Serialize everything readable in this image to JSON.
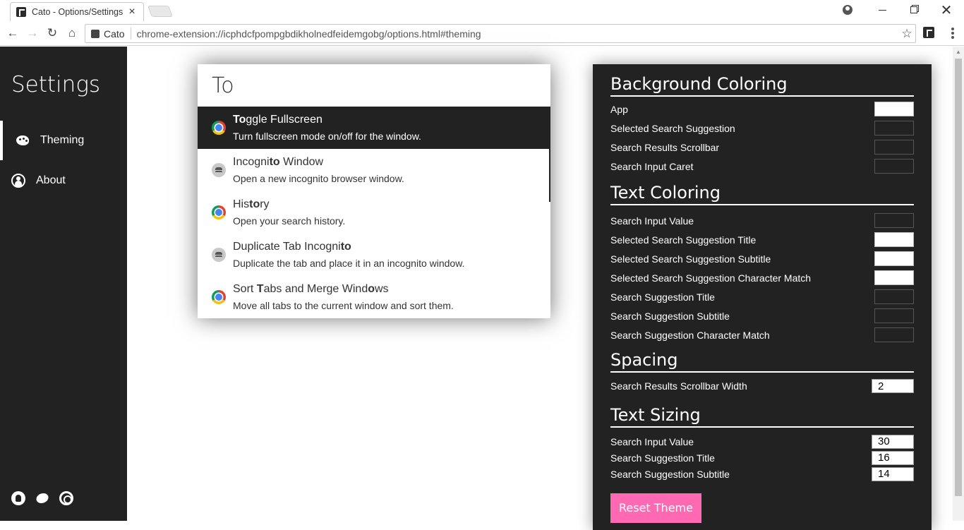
{
  "browser": {
    "tab_title": "Cato - Options/Settings",
    "tab_close": "×",
    "ext_chip_label": "Cato",
    "url": "chrome-extension://icphdcfpompgbdikholnedfeidemgobg/options.html#theming"
  },
  "sidebar": {
    "title": "Settings",
    "items": [
      {
        "label": "Theming",
        "icon": "palette-icon"
      },
      {
        "label": "About",
        "icon": "user-icon"
      }
    ],
    "social_icons": [
      "github-icon",
      "twitter-icon",
      "chrome-icon"
    ]
  },
  "preview": {
    "input_value": "To",
    "results": [
      {
        "title_parts": [
          [
            "To",
            true
          ],
          [
            "ggle Fullscreen",
            false
          ]
        ],
        "subtitle": "Turn fullscreen mode on/off for the window.",
        "icon": "chrome-icon",
        "selected": true
      },
      {
        "title_parts": [
          [
            "Incogni",
            false
          ],
          [
            "to",
            true
          ],
          [
            " Window",
            false
          ]
        ],
        "subtitle": "Open a new incognito browser window.",
        "icon": "incognito-icon",
        "selected": false
      },
      {
        "title_parts": [
          [
            "His",
            false
          ],
          [
            "to",
            true
          ],
          [
            "ry",
            false
          ]
        ],
        "subtitle": "Open your search history.",
        "icon": "chrome-icon",
        "selected": false
      },
      {
        "title_parts": [
          [
            "Duplicate Tab Incogni",
            false
          ],
          [
            "to",
            true
          ]
        ],
        "subtitle": "Duplicate the tab and place it in an incognito window.",
        "icon": "incognito-icon",
        "selected": false
      },
      {
        "title_parts": [
          [
            "Sort ",
            false
          ],
          [
            "T",
            true
          ],
          [
            "abs and Merge Wind",
            false
          ],
          [
            "o",
            true
          ],
          [
            "ws",
            false
          ]
        ],
        "subtitle": "Move all tabs to the current window and sort them.",
        "icon": "chrome-icon",
        "selected": false
      }
    ]
  },
  "panel": {
    "background": {
      "heading": "Background Coloring",
      "rows": [
        {
          "label": "App",
          "color": "#ffffff"
        },
        {
          "label": "Selected Search Suggestion",
          "color": "#222222"
        },
        {
          "label": "Search Results Scrollbar",
          "color": "#222222"
        },
        {
          "label": "Search Input Caret",
          "color": "#222222"
        }
      ]
    },
    "text": {
      "heading": "Text Coloring",
      "rows": [
        {
          "label": "Search Input Value",
          "color": "#222222"
        },
        {
          "label": "Selected Search Suggestion Title",
          "color": "#ffffff"
        },
        {
          "label": "Selected Search Suggestion Subtitle",
          "color": "#ffffff"
        },
        {
          "label": "Selected Search Suggestion Character Match",
          "color": "#ffffff"
        },
        {
          "label": "Search Suggestion Title",
          "color": "#222222"
        },
        {
          "label": "Search Suggestion Subtitle",
          "color": "#222222"
        },
        {
          "label": "Search Suggestion Character Match",
          "color": "#222222"
        }
      ]
    },
    "spacing": {
      "heading": "Spacing",
      "rows": [
        {
          "label": "Search Results Scrollbar Width",
          "value": "2"
        }
      ]
    },
    "sizing": {
      "heading": "Text Sizing",
      "rows": [
        {
          "label": "Search Input Value",
          "value": "30"
        },
        {
          "label": "Search Suggestion Title",
          "value": "16"
        },
        {
          "label": "Search Suggestion Subtitle",
          "value": "14"
        }
      ]
    },
    "reset_label": "Reset Theme"
  },
  "colors": {
    "sidebar_bg": "#222222",
    "accent_pink": "#ff69b4",
    "panel_bg": "#222222"
  }
}
